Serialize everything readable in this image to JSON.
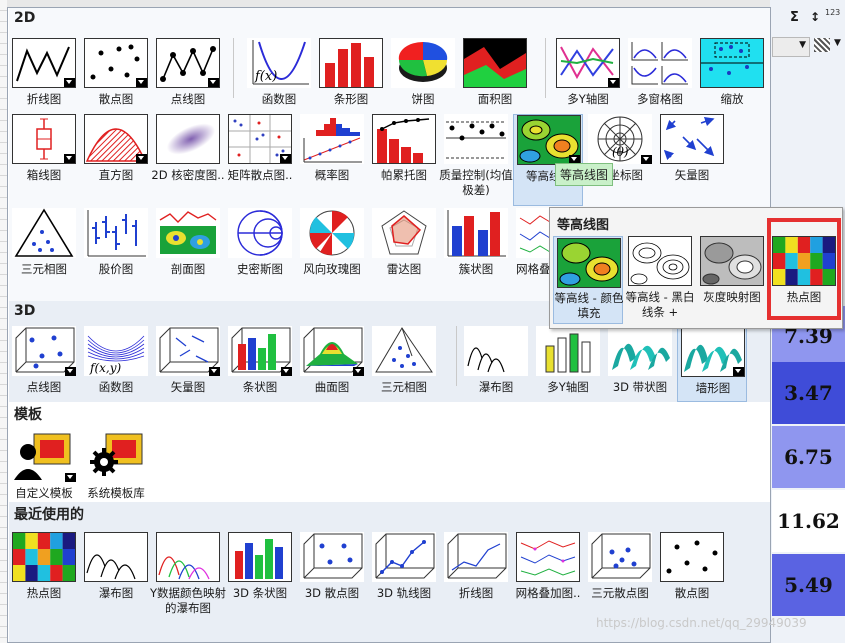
{
  "app": {
    "right_cells": [
      "7.39",
      "3.47",
      "6.75",
      "11.62",
      "5.49"
    ],
    "right_cell_colors": [
      "#8f96ef",
      "#3f4cd8",
      "#8f96ef",
      "#ffffff",
      "#5a63e2"
    ]
  },
  "sections": {
    "s2d": {
      "title": "2D"
    },
    "s3d": {
      "title": "3D"
    },
    "templates": {
      "title": "模板"
    },
    "recent": {
      "title": "最近使用的"
    }
  },
  "items": {
    "line": "折线图",
    "scatter": "散点图",
    "line_symbol": "点线图",
    "function": "函数图",
    "bar": "条形图",
    "pie": "饼图",
    "area": "面积图",
    "multi_y": "多Y轴图",
    "multi_panel": "多窗格图",
    "zoom": "缩放",
    "box": "箱线图",
    "histogram": "直方图",
    "kde": "2D 核密度图..",
    "matrix_scatter": "矩阵散点图..",
    "probability": "概率图",
    "pareto": "帕累托图",
    "quality": "质量控制(均值极差)",
    "contour": "等高线图",
    "polar": "极坐标图",
    "vector": "矢量图",
    "ternary": "三元相图",
    "stock": "股价图",
    "profile": "剖面图",
    "smith": "史密斯图",
    "wind_rose": "风向玫瑰图",
    "radar": "雷达图",
    "column": "簇状图",
    "grid_overlay": "网格叠..",
    "3d_scatter": "点线图",
    "3d_function": "函数图",
    "3d_vector": "矢量图",
    "3d_bar": "条状图",
    "3d_surface": "曲面图",
    "3d_ternary": "三元相图",
    "waterfall": "瀑布图",
    "3d_multi_y": "多Y轴图",
    "3d_ribbon": "3D 带状图",
    "3d_wall": "墙形图",
    "user_template": "自定义模板",
    "system_template": "系统模板库",
    "r_heatmap": "热点图",
    "r_waterfall": "瀑布图",
    "r_ycolor_waterfall": "Y数据颜色映射的瀑布图",
    "r_3d_bar": "3D 条状图",
    "r_3d_scatter": "3D 散点图",
    "r_3d_trajectory": "3D 轨线图",
    "r_line": "折线图",
    "r_grid_overlay": "网格叠加图..",
    "r_ternary_scatter": "三元散点图",
    "r_scatter": "散点图"
  },
  "tooltip": "等高线图",
  "popup": {
    "title": "等高线图",
    "items": {
      "color_fill": "等高线 - 颜色填充",
      "bw_lines": "等高线 - 黑白线条 +",
      "gray_map": "灰度映射图",
      "heatmap": "热点图"
    }
  },
  "watermark": "https://blog.csdn.net/qq_29949039",
  "icons": {
    "sum": "sum-icon",
    "sort": "sort-icon",
    "dropdown": "dropdown-arrow-icon"
  },
  "colors": {
    "highlight_box": "#e53030",
    "tooltip_bg": "#c9f0c9",
    "panel_border": "#9aa4b3",
    "section_bg": "#e9eef5"
  }
}
